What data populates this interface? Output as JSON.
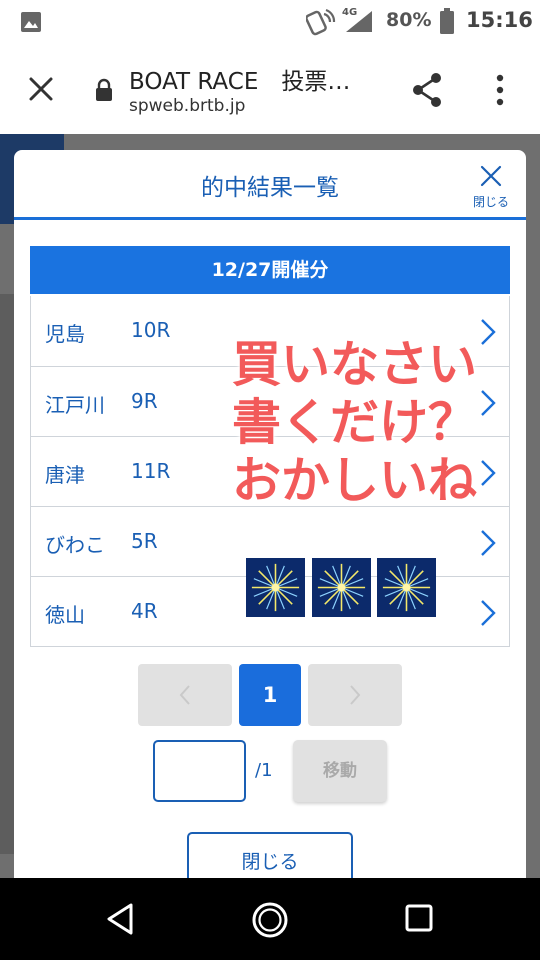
{
  "status_bar": {
    "network": "4G",
    "battery": "80%",
    "time": "15:16",
    "icons": [
      "gallery-icon",
      "nfc-icon",
      "signal-icon",
      "battery-icon"
    ]
  },
  "browser": {
    "title": "BOAT RACE　投票…",
    "url": "spweb.brtb.jp",
    "icons": [
      "close-icon",
      "lock-icon",
      "share-icon",
      "more-vert-icon"
    ]
  },
  "modal": {
    "title": "的中結果一覧",
    "close_label": "閉じる",
    "date_header": "12/27開催分",
    "races": [
      {
        "venue": "児島",
        "race": "10R"
      },
      {
        "venue": "江戸川",
        "race": "9R"
      },
      {
        "venue": "唐津",
        "race": "11R"
      },
      {
        "venue": "びわこ",
        "race": "5R"
      },
      {
        "venue": "徳山",
        "race": "4R"
      }
    ],
    "pagination": {
      "prev": "‹",
      "current_page": "1",
      "next": "›",
      "input_value": "",
      "total": "/1",
      "move_label": "移動"
    },
    "footer_close": "閉じる"
  },
  "overlay": {
    "lines": [
      "買いなさい",
      "書くだけ？",
      "おかしいね"
    ],
    "sticker": "fireworks-sticker",
    "color": "#f25a5a"
  },
  "colors": {
    "accent": "#1a6fd8",
    "text_blue": "#1a5fb4"
  },
  "nav_bar": {
    "icons": [
      "back-icon",
      "home-icon",
      "recents-icon"
    ]
  }
}
